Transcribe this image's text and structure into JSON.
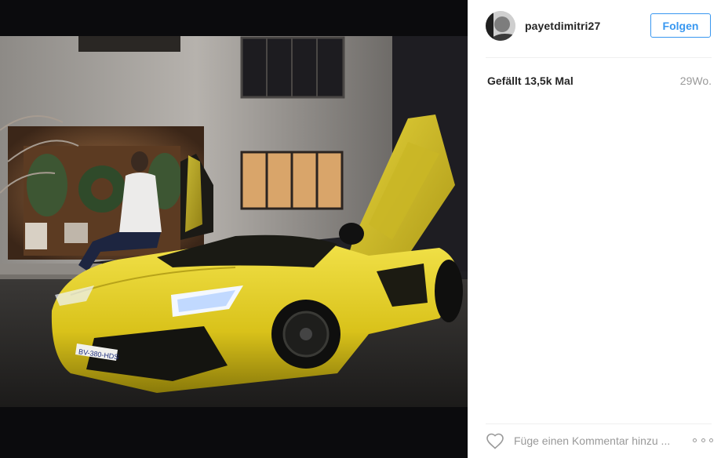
{
  "post": {
    "username": "payetdimitri27",
    "follow_label": "Folgen",
    "likes_text": "Gefällt 13,5k Mal",
    "age_text": "29Wo.",
    "comment_placeholder": "Füge einen Kommentar hinzu ...",
    "photo_plate_text": "BV-380-HDS"
  },
  "icons": {
    "like": "heart-outline-icon",
    "more": "more-options-icon"
  },
  "colors": {
    "accent": "#3897f0",
    "text": "#262626",
    "muted": "#999999",
    "car_yellow": "#e8d200"
  }
}
